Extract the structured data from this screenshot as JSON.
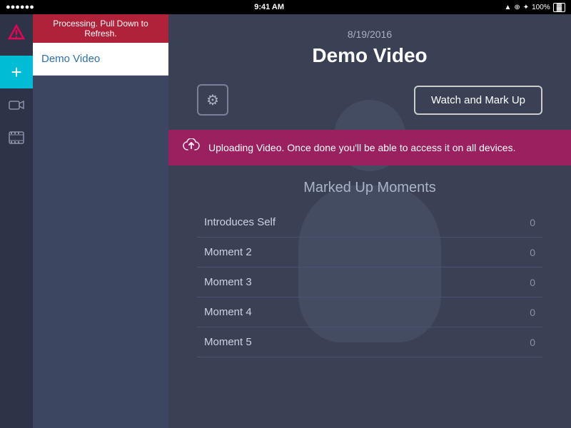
{
  "statusBar": {
    "leftDots": "●●●●●●",
    "wifi": "wifi",
    "time": "9:41 AM",
    "rightIcons": "▲ ⊕ ♦ 🔋",
    "battery": "100%"
  },
  "sidebar": {
    "processingLabel": "Processing. Pull Down to Refresh.",
    "item": "Demo Video"
  },
  "railIcons": {
    "logo": "▽",
    "add": "+",
    "camera": "📹",
    "film": "🎞"
  },
  "main": {
    "date": "8/19/2016",
    "title": "Demo Video",
    "gearLabel": "⚙",
    "watchButtonLabel": "Watch and Mark Up",
    "uploadBanner": "Uploading Video. Once done you'll be able to access it on all devices.",
    "momentsTitle": "Marked Up Moments",
    "moments": [
      {
        "label": "Introduces Self",
        "count": "0"
      },
      {
        "label": "Moment 2",
        "count": "0"
      },
      {
        "label": "Moment 3",
        "count": "0"
      },
      {
        "label": "Moment 4",
        "count": "0"
      },
      {
        "label": "Moment 5",
        "count": "0"
      }
    ]
  }
}
